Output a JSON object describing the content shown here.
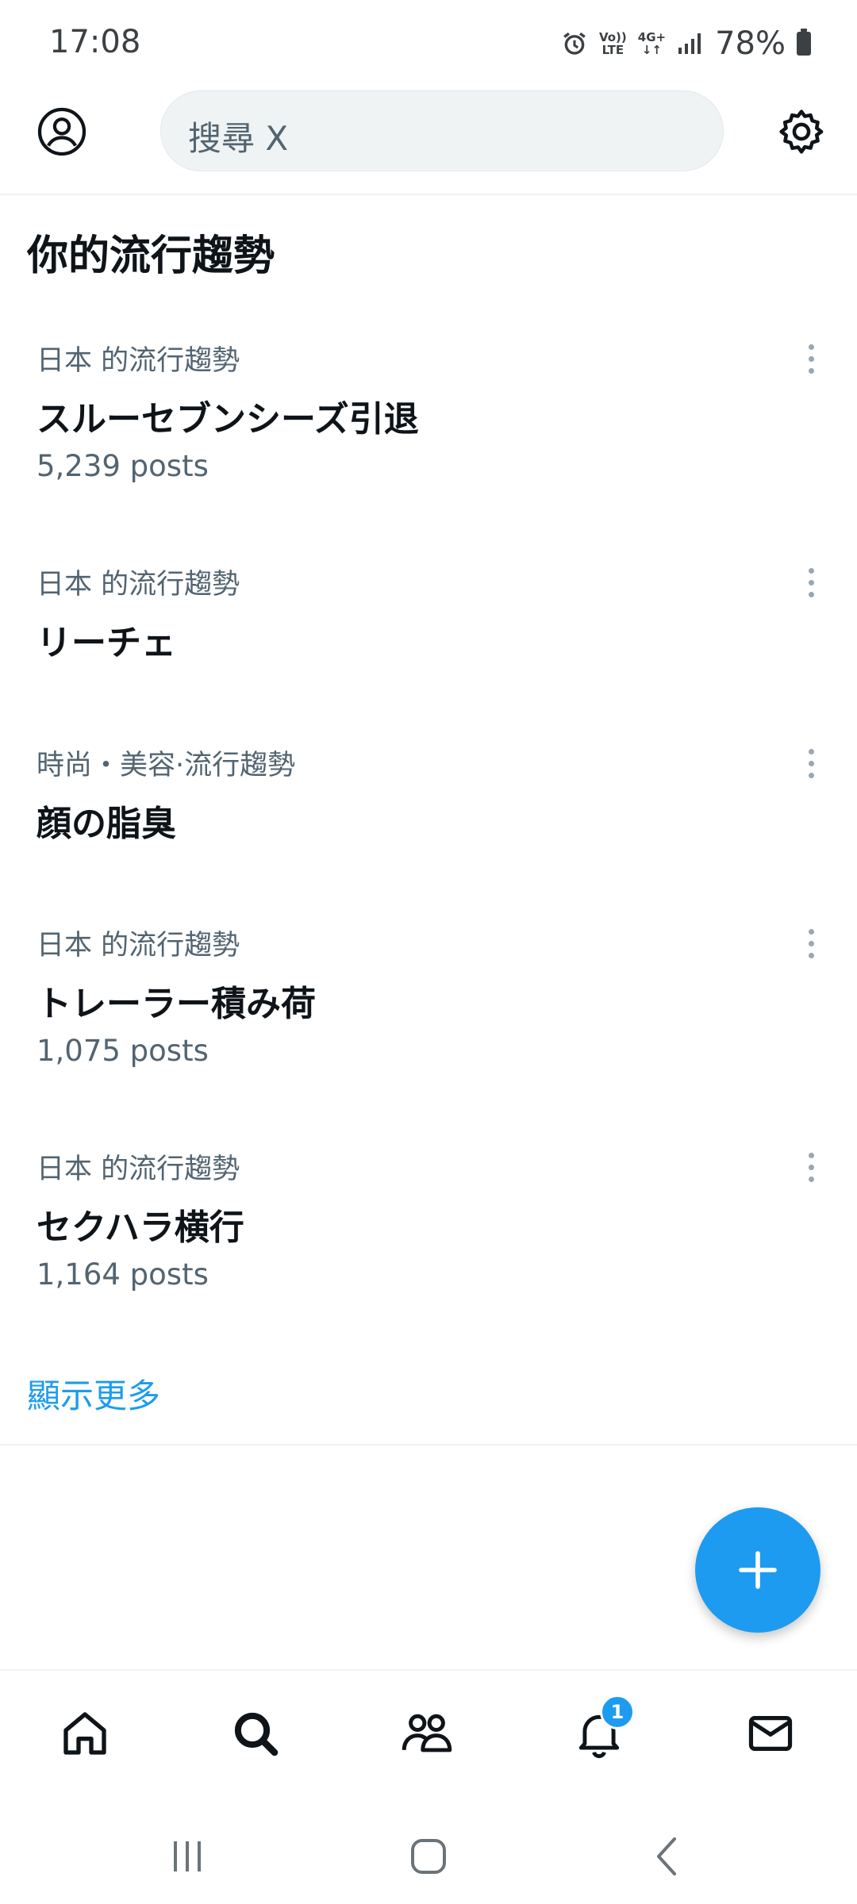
{
  "status_bar": {
    "time": "17:08",
    "volte_line1": "Vo))",
    "volte_line2": "LTE",
    "network": "4G+",
    "battery": "78%"
  },
  "header": {
    "search_placeholder": "搜尋 X"
  },
  "section": {
    "title": "你的流行趨勢"
  },
  "trends": [
    {
      "category": "日本 的流行趨勢",
      "name": "スルーセブンシーズ引退",
      "posts": "5,239 posts"
    },
    {
      "category": "日本 的流行趨勢",
      "name": "リーチェ",
      "posts": ""
    },
    {
      "category": "時尚・美容·流行趨勢",
      "name": "顔の脂臭",
      "posts": ""
    },
    {
      "category": "日本 的流行趨勢",
      "name": "トレーラー積み荷",
      "posts": "1,075 posts"
    },
    {
      "category": "日本 的流行趨勢",
      "name": "セクハラ横行",
      "posts": "1,164 posts"
    }
  ],
  "show_more": "顯示更多",
  "bottom_nav": {
    "notification_badge": "1"
  },
  "colors": {
    "accent": "#1d9bf0",
    "secondary_text": "#536471",
    "primary_text": "#0f1419"
  }
}
